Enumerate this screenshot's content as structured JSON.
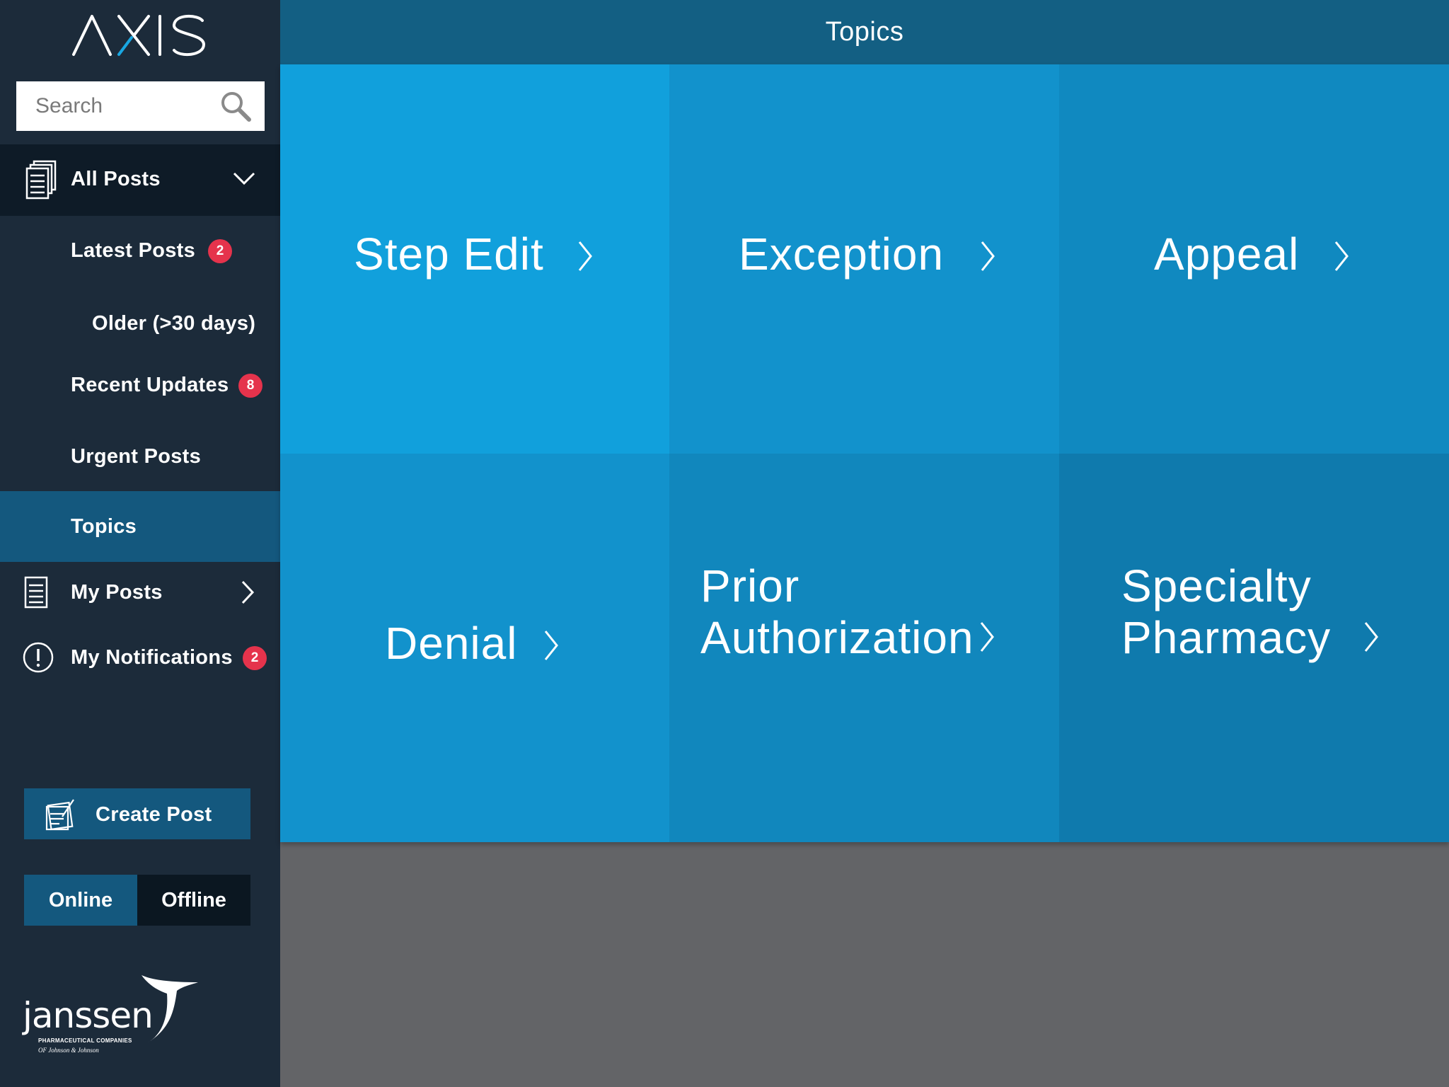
{
  "app": {
    "logo_text": "AXIS"
  },
  "search": {
    "placeholder": "Search"
  },
  "sidebar": {
    "all_posts": "All Posts",
    "latest_posts": {
      "label": "Latest Posts",
      "badge": "2"
    },
    "older": "Older (>30 days)",
    "recent_updates": {
      "label": "Recent Updates",
      "badge": "8"
    },
    "urgent_posts": "Urgent Posts",
    "topics": "Topics",
    "my_posts": "My Posts",
    "my_notifications": {
      "label": "My Notifications",
      "badge": "2"
    },
    "create_post": "Create Post",
    "mode": {
      "online": "Online",
      "offline": "Offline",
      "selected": "Online"
    },
    "brand": {
      "name": "janssen",
      "tagline_1": "PHARMACEUTICAL COMPANIES",
      "tagline_2": "OF Johnson & Johnson"
    }
  },
  "header": {
    "title": "Topics"
  },
  "topics": [
    {
      "label": "Step Edit"
    },
    {
      "label": "Exception"
    },
    {
      "label": "Appeal"
    },
    {
      "label": "Denial"
    },
    {
      "label_line1": "Prior",
      "label_line2": "Authorization"
    },
    {
      "label_line1": "Specialty",
      "label_line2": "Pharmacy"
    }
  ],
  "colors": {
    "sidebar_bg": "#1c2b3a",
    "active_item": "#14587e",
    "header_bg": "#135f83",
    "badge": "#e5334c",
    "tile_1": "#11a0dc",
    "tile_6": "#0f7aad",
    "content_bg": "#636467"
  }
}
